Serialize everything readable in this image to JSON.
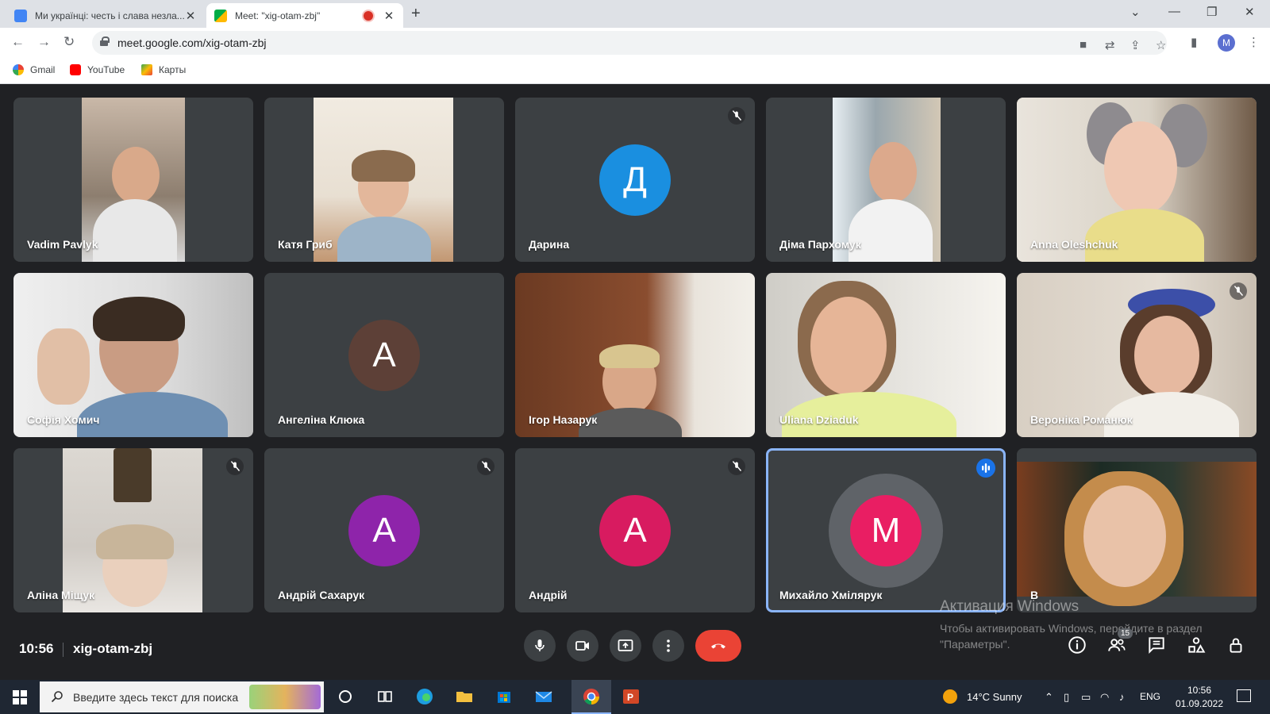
{
  "browser": {
    "tabs": [
      {
        "title": "Ми українці: честь і слава незла...",
        "active": false
      },
      {
        "title": "Meet: \"xig-otam-zbj\"",
        "active": true
      }
    ],
    "url": "meet.google.com/xig-otam-zbj",
    "profile_initial": "M",
    "bookmarks": [
      "Gmail",
      "YouTube",
      "Карты"
    ]
  },
  "meeting": {
    "time": "10:56",
    "code": "xig-otam-zbj",
    "participants_count": "15",
    "participants": [
      {
        "name": "Vadim Pavlyk"
      },
      {
        "name": "Катя Гриб"
      },
      {
        "name": "Дарина",
        "initial": "Д",
        "color": "#1a8fe0",
        "muted": true
      },
      {
        "name": "Діма Пархомук"
      },
      {
        "name": "Anna Oleshchuk"
      },
      {
        "name": "Софія Хомич"
      },
      {
        "name": "Ангеліна Клюка",
        "initial": "А",
        "color": "#5d4037"
      },
      {
        "name": "Ігор Назарук"
      },
      {
        "name": "Uliana Dziaduk"
      },
      {
        "name": "Вероніка Романюк",
        "muted": true
      },
      {
        "name": "Аліна Міщук",
        "muted": true
      },
      {
        "name": "Андрій Сахарук",
        "initial": "А",
        "color": "#8e24aa",
        "muted": true
      },
      {
        "name": "Андрій",
        "initial": "А",
        "color": "#d81b60",
        "muted": true
      },
      {
        "name": "Михайло Хмілярук",
        "initial": "M",
        "color": "#e91e63",
        "speaking": true
      },
      {
        "name": "В"
      }
    ]
  },
  "watermark": {
    "title": "Активация Windows",
    "text": "Чтобы активировать Windows, перейдите в раздел \"Параметры\"."
  },
  "taskbar": {
    "search_placeholder": "Введите здесь текст для поиска",
    "weather": "14°C  Sunny",
    "language": "ENG",
    "time": "10:56",
    "date": "01.09.2022"
  },
  "colors": {
    "tile_bg": "#3c4043",
    "accent": "#8ab4f8",
    "hangup": "#ea4335"
  }
}
